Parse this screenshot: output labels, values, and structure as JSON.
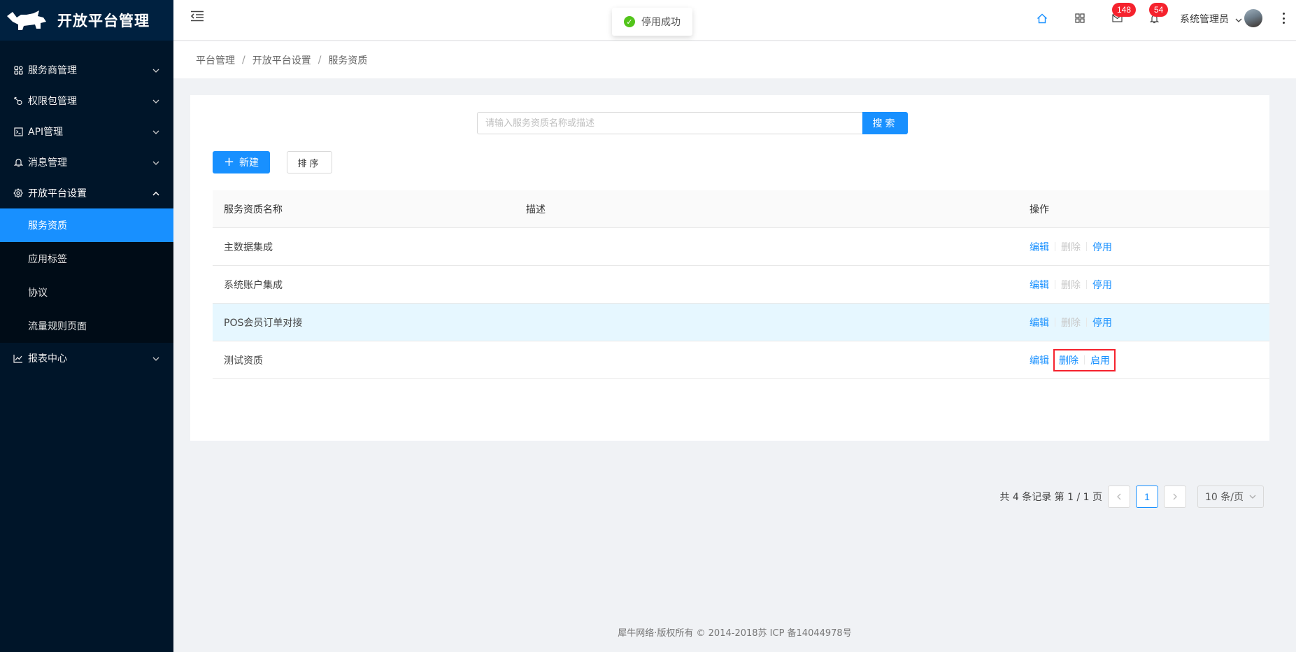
{
  "app": {
    "title": "开放平台管理"
  },
  "sidebar": {
    "items": [
      {
        "label": "服务商管理",
        "icon": "apps-icon"
      },
      {
        "label": "权限包管理",
        "icon": "key-icon"
      },
      {
        "label": "API管理",
        "icon": "code-icon"
      },
      {
        "label": "消息管理",
        "icon": "bell-icon"
      },
      {
        "label": "开放平台设置",
        "icon": "gear-icon",
        "expanded": true
      },
      {
        "label": "报表中心",
        "icon": "chart-icon"
      }
    ],
    "sub_items": [
      {
        "label": "服务资质",
        "active": true
      },
      {
        "label": "应用标签"
      },
      {
        "label": "协议"
      },
      {
        "label": "流量规则页面"
      }
    ]
  },
  "header": {
    "toast": "停用成功",
    "mail_badge": "148",
    "bell_badge": "54",
    "user_name": "系统管理员"
  },
  "breadcrumb": [
    "平台管理",
    "开放平台设置",
    "服务资质"
  ],
  "toolbar": {
    "search_placeholder": "请输入服务资质名称或描述",
    "search_label": "搜索",
    "new_label": "新建",
    "sort_label": "排序"
  },
  "table": {
    "headers": [
      "服务资质名称",
      "描述",
      "操作"
    ],
    "rows": [
      {
        "name": "主数据集成",
        "desc": "",
        "edit": "编辑",
        "delete": "删除",
        "toggle": "停用"
      },
      {
        "name": "系统账户集成",
        "desc": "",
        "edit": "编辑",
        "delete": "删除",
        "toggle": "停用"
      },
      {
        "name": "POS会员订单对接",
        "desc": "",
        "edit": "编辑",
        "delete": "删除",
        "toggle": "停用"
      },
      {
        "name": "测试资质",
        "desc": "",
        "edit": "编辑",
        "delete": "删除",
        "toggle": "启用"
      }
    ]
  },
  "pagination": {
    "summary": "共 4 条记录 第 1 / 1 页",
    "current": "1",
    "page_size": "10 条/页"
  },
  "footer": "犀牛网络·版权所有 © 2014-2018苏 ICP 备14044978号",
  "colors": {
    "primary": "#1890ff",
    "sidebar": "#001529",
    "highlight": "#f5222d"
  }
}
